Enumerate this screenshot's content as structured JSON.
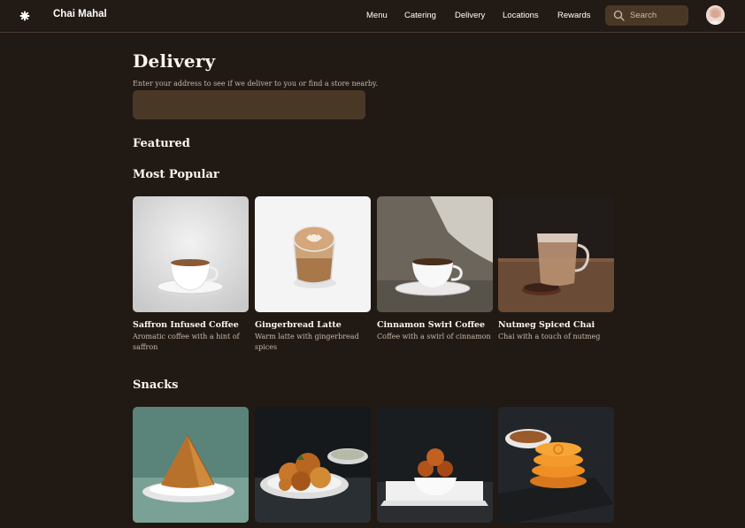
{
  "header": {
    "brand": "Chai Mahal",
    "nav": [
      "Menu",
      "Catering",
      "Delivery",
      "Locations",
      "Rewards"
    ],
    "search_placeholder": "Search"
  },
  "main": {
    "title": "Delivery",
    "hint": "Enter your address to see if we deliver to you or find a store nearby.",
    "address_value": "",
    "featured_heading": "Featured",
    "popular_heading": "Most Popular",
    "popular": [
      {
        "title": "Saffron Infused Coffee",
        "desc": "Aromatic coffee with a hint of saffron"
      },
      {
        "title": "Gingerbread Latte",
        "desc": "Warm latte with gingerbread spices"
      },
      {
        "title": "Cinnamon Swirl Coffee",
        "desc": "Coffee with a swirl of cinnamon"
      },
      {
        "title": "Nutmeg Spiced Chai",
        "desc": "Chai with a touch of nutmeg"
      }
    ],
    "snacks_heading": "Snacks"
  },
  "colors": {
    "background": "#211914",
    "input": "#4a3827",
    "muted_text": "#c9b9a8"
  }
}
